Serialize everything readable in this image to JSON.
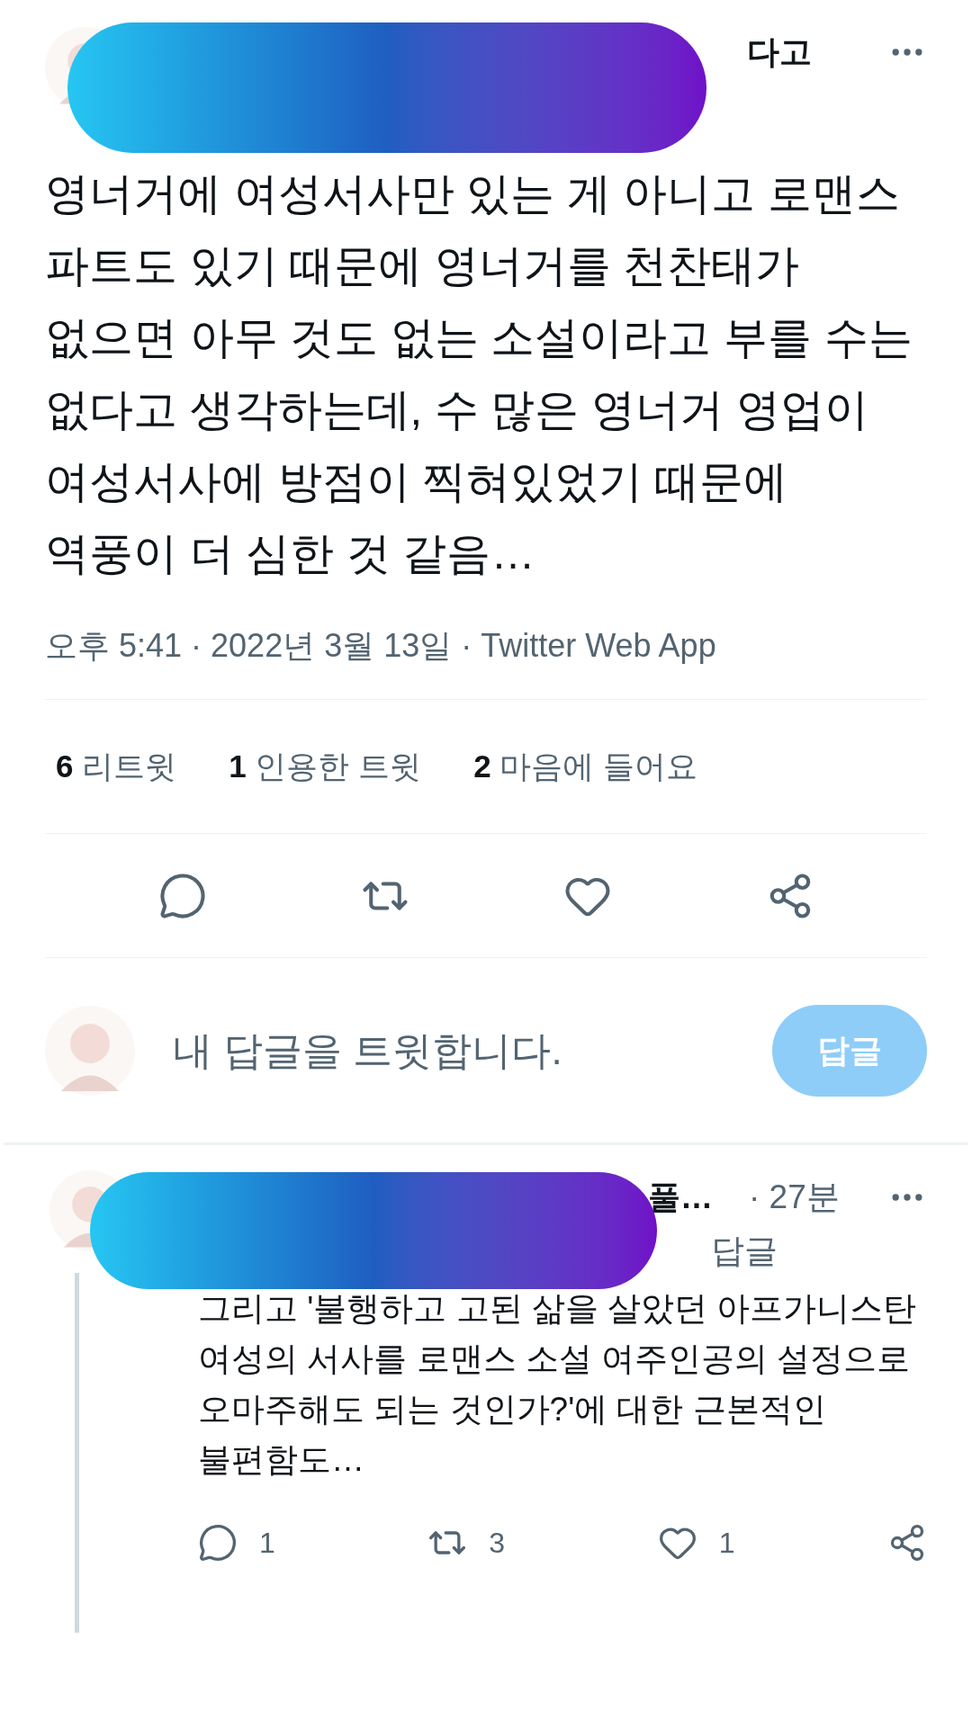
{
  "tweet": {
    "author_name": "다고",
    "text": "영너거에 여성서사만 있는 게 아니고 로맨스 파트도 있기 때문에 영너거를 천찬태가 없으면 아무 것도 없는 소설이라고 부를 수는 없다고 생각하는데, 수 많은 영너거 영업이 여성서사에 방점이 찍혀있었기 때문에 역풍이 더 심한 것 같음…",
    "meta": "오후 5:41 · 2022년 3월 13일 · Twitter Web App",
    "stats": [
      {
        "count": "6",
        "label": "리트윗"
      },
      {
        "count": "1",
        "label": "인용한 트윗"
      },
      {
        "count": "2",
        "label": "마음에 들어요"
      }
    ],
    "actions": [
      {
        "kind": "reply"
      },
      {
        "kind": "retweet"
      },
      {
        "kind": "like"
      },
      {
        "kind": "share"
      }
    ]
  },
  "composer": {
    "placeholder": "내 답글을 트윗합니다.",
    "button": "답글",
    "disabled": true
  },
  "reply": {
    "author_name": "풀…",
    "time": "· 27분",
    "context": "답글",
    "text": "그리고 '불행하고 고된 삶을 살았던 아프가니스탄 여성의 서사를 로맨스 소설 여주인공의 설정으로 오마주해도 되는 것인가?'에 대한 근본적인 불편함도…",
    "actions": [
      {
        "kind": "reply",
        "count": "1"
      },
      {
        "kind": "retweet",
        "count": "3"
      },
      {
        "kind": "like",
        "count": "1"
      },
      {
        "kind": "share"
      }
    ]
  }
}
